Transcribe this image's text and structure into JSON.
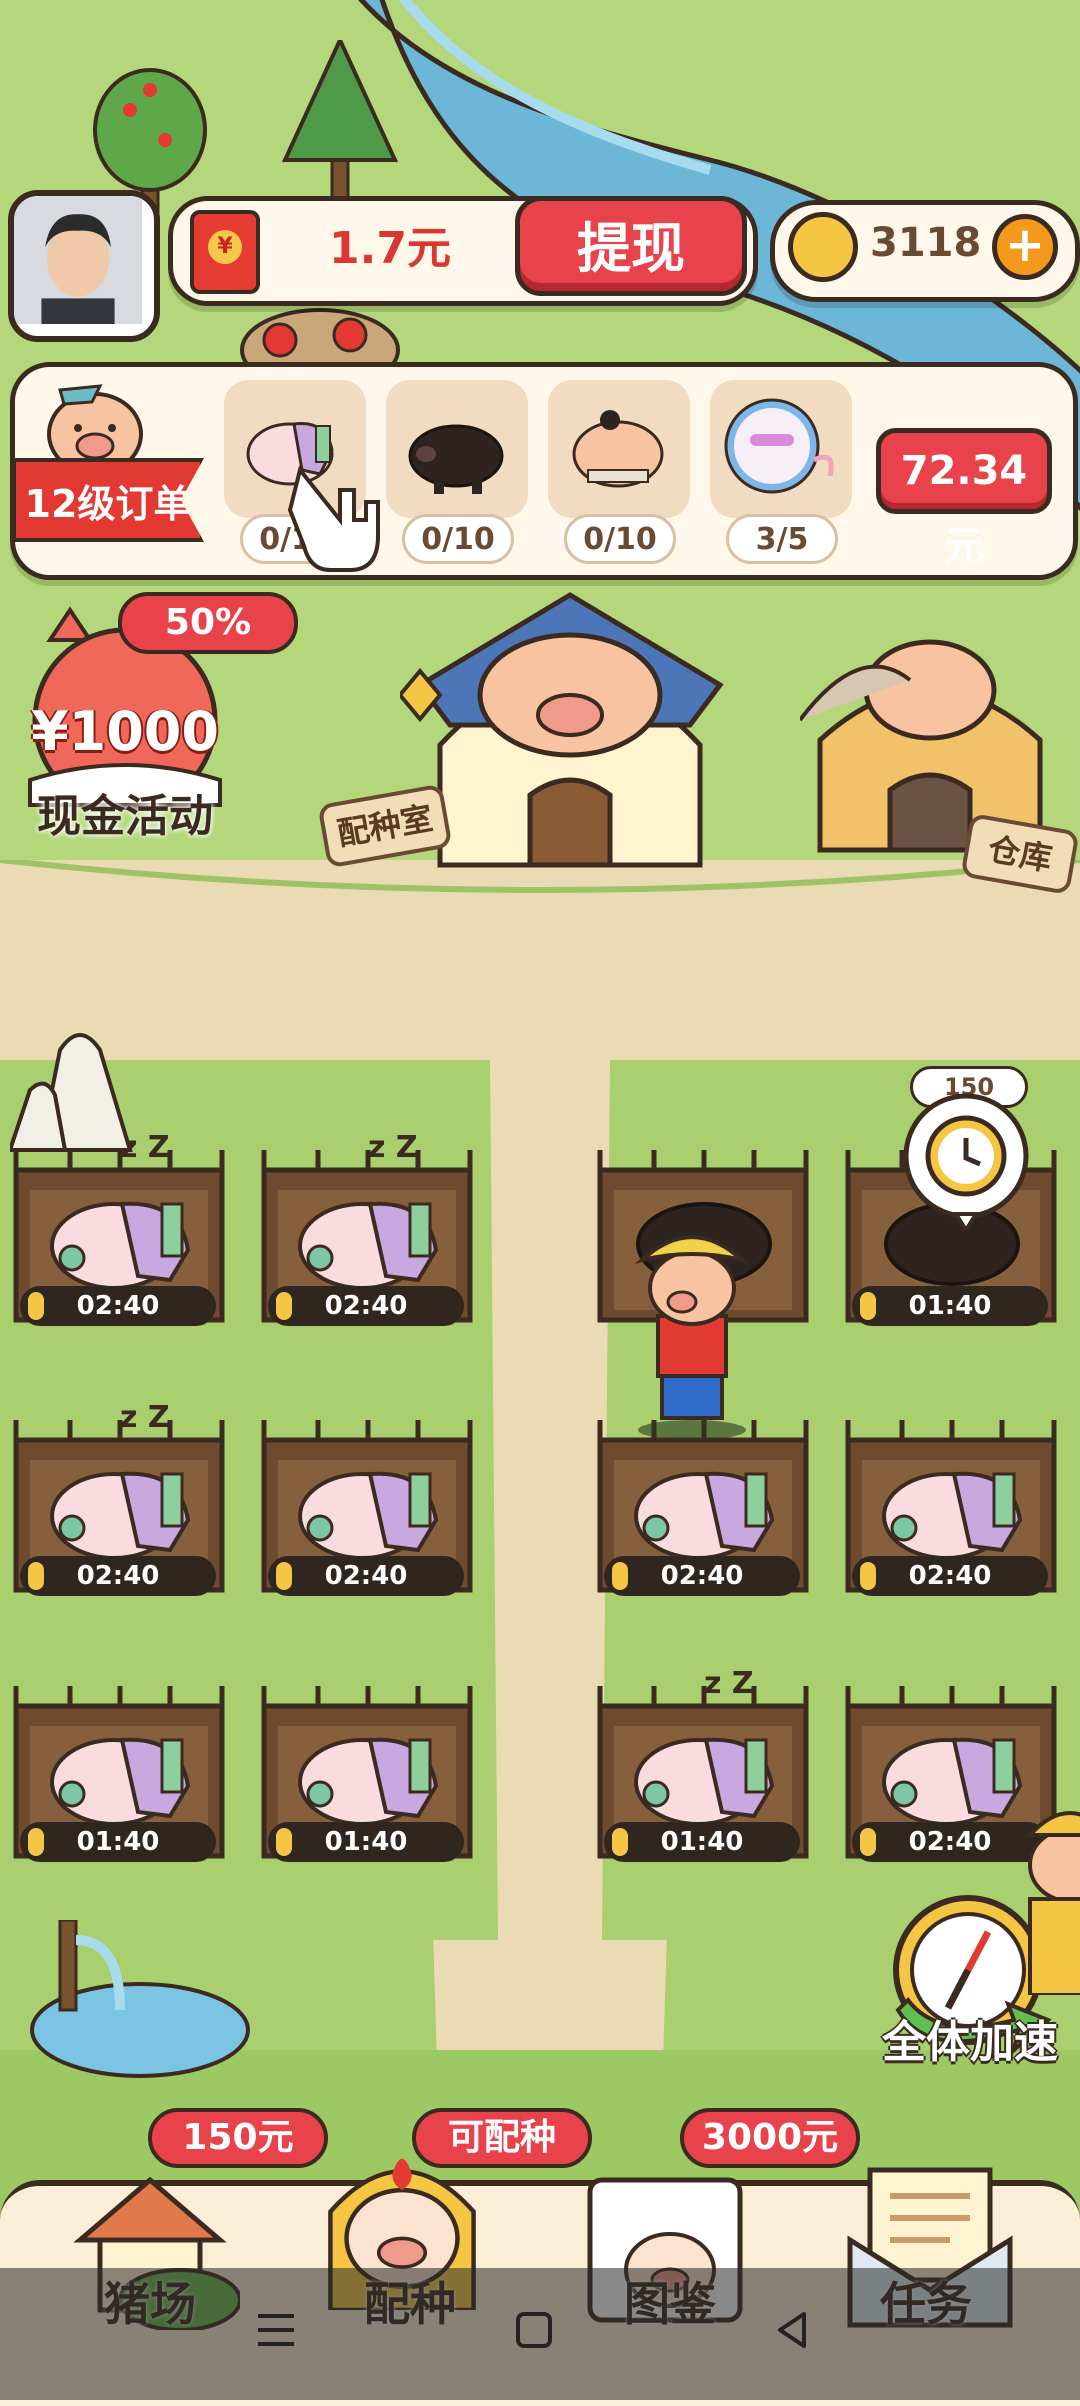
{
  "header": {
    "cash_amount": "1.7元",
    "withdraw_label": "提现",
    "coin_count": "3118",
    "coin_add_symbol": "+"
  },
  "order": {
    "level_label": "12级订单",
    "items": [
      {
        "pig": "baby-pig-icon",
        "count": "0/10"
      },
      {
        "pig": "black-pig-icon",
        "count": "0/10"
      },
      {
        "pig": "sumo-pig-icon",
        "count": "0/10"
      },
      {
        "pig": "space-pig-icon",
        "count": "3/5"
      }
    ],
    "reward_label": "72.34元"
  },
  "cash_event": {
    "percent": "50%",
    "amount": "¥1000",
    "label": "现金活动"
  },
  "buildings": {
    "breeding_label": "配种室",
    "warehouse_label": "仓库"
  },
  "pens": [
    {
      "timer": "02:40",
      "pig": "baby-pig-icon",
      "sleeping": true
    },
    {
      "timer": "02:40",
      "pig": "baby-pig-icon",
      "sleeping": true
    },
    {
      "timer": "",
      "pig": "black-pig-icon",
      "sleeping": false
    },
    {
      "timer": "01:40",
      "pig": "black-pig-icon",
      "sleeping": false
    },
    {
      "timer": "02:40",
      "pig": "baby-pig-icon",
      "sleeping": true
    },
    {
      "timer": "02:40",
      "pig": "baby-pig-icon",
      "sleeping": false
    },
    {
      "timer": "02:40",
      "pig": "baby-pig-icon",
      "sleeping": false
    },
    {
      "timer": "02:40",
      "pig": "baby-pig-icon",
      "sleeping": false
    },
    {
      "timer": "01:40",
      "pig": "baby-pig-icon",
      "sleeping": false
    },
    {
      "timer": "01:40",
      "pig": "baby-pig-icon",
      "sleeping": false
    },
    {
      "timer": "01:40",
      "pig": "baby-pig-icon",
      "sleeping": true
    },
    {
      "timer": "02:40",
      "pig": "baby-pig-icon",
      "sleeping": false
    }
  ],
  "speedup": {
    "coin_cost": "150",
    "boost_all_label": "全体加速"
  },
  "nav": {
    "items": [
      {
        "label": "猪场",
        "badge": "150元",
        "icon": "farm-house-icon"
      },
      {
        "label": "配种",
        "badge": "可配种",
        "icon": "breeding-pig-icon"
      },
      {
        "label": "图鉴",
        "badge": "3000元",
        "icon": "album-book-icon"
      },
      {
        "label": "任务",
        "badge": "",
        "icon": "task-envelope-icon"
      }
    ]
  },
  "colors": {
    "accent_red": "#e8434a",
    "gold": "#f4c643",
    "outline": "#3b2a1f",
    "grass": "#b3d77a",
    "dirt": "#eadbb4"
  }
}
